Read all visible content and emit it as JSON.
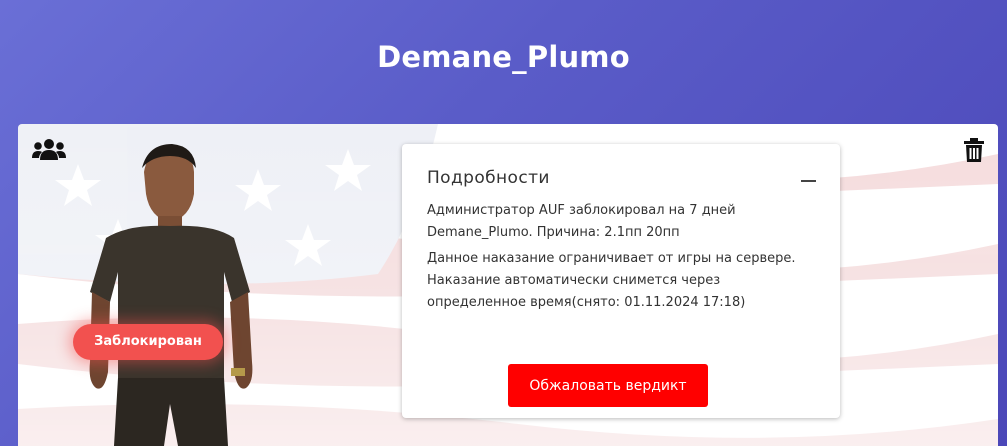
{
  "page": {
    "title": "Demane_Plumo"
  },
  "card": {
    "status_badge": "Заблокирован",
    "group_icon": "users-group-icon",
    "delete_icon": "trash-icon"
  },
  "details": {
    "title": "Подробности",
    "collapse_icon": "minus-icon",
    "line1": "Администратор AUF заблокировал на 7 дней Demane_Plumo. Причина: 2.1пп 20пп",
    "line2": "Данное наказание ограничивает от игры на сервере. Наказание автоматически снимется через определенное время(снято: 01.11.2024 17:18)",
    "appeal_button": "Обжаловать вердикт"
  },
  "colors": {
    "background_start": "#6a6fd6",
    "background_end": "#4b47b8",
    "badge": "#f2514f",
    "appeal_button": "#ff0000"
  }
}
